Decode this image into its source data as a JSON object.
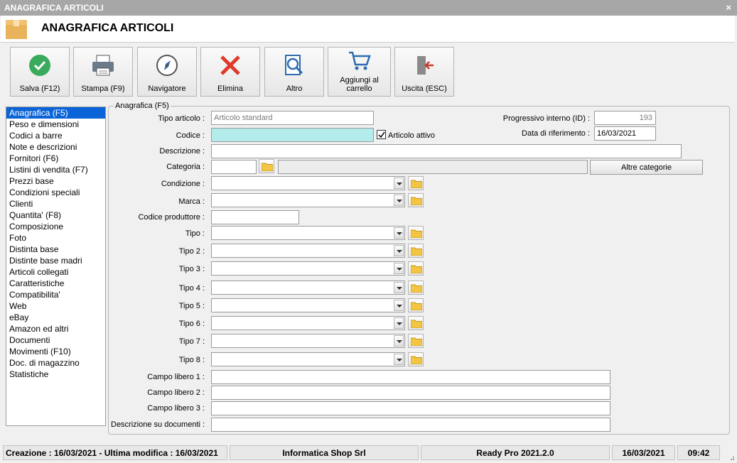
{
  "window": {
    "title": "ANAGRAFICA ARTICOLI",
    "close": "×"
  },
  "header": {
    "title": "ANAGRAFICA ARTICOLI"
  },
  "toolbar": {
    "save": "Salva (F12)",
    "print": "Stampa (F9)",
    "navigator": "Navigatore",
    "delete": "Elimina",
    "other": "Altro",
    "cart_line1": "Aggiungi al",
    "cart_line2": "carrello",
    "exit": "Uscita (ESC)"
  },
  "nav": {
    "items": [
      "Anagrafica (F5)",
      "Peso e dimensioni",
      "Codici a barre",
      "Note e descrizioni",
      "Fornitori (F6)",
      "Listini di vendita (F7)",
      "Prezzi base",
      "Condizioni speciali",
      "Clienti",
      "Quantita' (F8)",
      "Composizione",
      "Foto",
      "Distinta base",
      "Distinte base madri",
      "Articoli collegati",
      "Caratteristiche",
      "Compatibilita'",
      "Web",
      "eBay",
      "Amazon ed altri",
      "Documenti",
      "Movimenti (F10)",
      "Doc. di magazzino",
      "Statistiche"
    ],
    "selected_index": 0
  },
  "form": {
    "legend": "Anagrafica (F5)",
    "tipo_articolo": {
      "label": "Tipo articolo :",
      "value": "Articolo standard"
    },
    "codice": {
      "label": "Codice :",
      "value": ""
    },
    "articolo_attivo": {
      "label": "Articolo attivo",
      "checked": true
    },
    "progressivo": {
      "label": "Progressivo interno (ID) :",
      "value": "193"
    },
    "data_riferimento": {
      "label": "Data di riferimento :",
      "value": "16/03/2021"
    },
    "descrizione": {
      "label": "Descrizione :",
      "value": ""
    },
    "categoria": {
      "label": "Categoria :",
      "value": "",
      "description": "",
      "button": "Altre categorie"
    },
    "condizione": {
      "label": "Condizione :",
      "value": ""
    },
    "marca": {
      "label": "Marca :",
      "value": ""
    },
    "codice_produttore": {
      "label": "Codice produttore :",
      "value": ""
    },
    "tipi": [
      {
        "label": "Tipo :",
        "value": ""
      },
      {
        "label": "Tipo 2 :",
        "value": ""
      },
      {
        "label": "Tipo 3 :",
        "value": ""
      },
      {
        "label": "Tipo 4 :",
        "value": ""
      },
      {
        "label": "Tipo 5 :",
        "value": ""
      },
      {
        "label": "Tipo 6 :",
        "value": ""
      },
      {
        "label": "Tipo 7 :",
        "value": ""
      },
      {
        "label": "Tipo 8 :",
        "value": ""
      }
    ],
    "campi_liberi": [
      {
        "label": "Campo libero 1 :",
        "value": ""
      },
      {
        "label": "Campo libero 2 :",
        "value": ""
      },
      {
        "label": "Campo libero 3 :",
        "value": ""
      }
    ],
    "descrizione_documenti": {
      "label": "Descrizione su documenti :",
      "value": ""
    }
  },
  "status": {
    "dates": "Creazione : 16/03/2021 - Ultima modifica : 16/03/2021",
    "company": "Informatica Shop Srl",
    "product": "Ready Pro 2021.2.0",
    "date": "16/03/2021",
    "time": "09:42"
  },
  "colors": {
    "nav_selected": "#0a64d8",
    "codice_bg": "#b4ecec",
    "ok_green": "#3aaa5c",
    "delete_red": "#e03a2a"
  }
}
